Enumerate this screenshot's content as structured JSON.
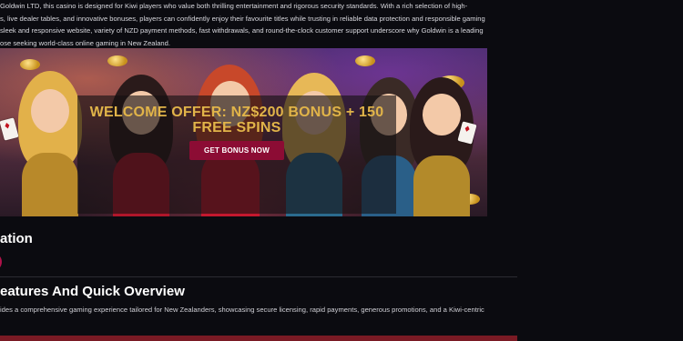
{
  "intro": {
    "lines": [
      "Goldwin LTD, this casino is designed for Kiwi players who value both thrilling entertainment and rigorous security standards. With a rich selection of high-",
      "s, live dealer tables, and innovative bonuses, players can confidently enjoy their favourite titles while trusting in reliable data protection and responsible gaming",
      "sleek and responsive website, variety of NZD payment methods, fast withdrawals, and round-the-clock customer support underscore why Goldwin is a leading",
      "ose seeking world-class online gaming in New Zealand."
    ]
  },
  "banner": {
    "offer_title": "WELCOME OFFER: NZ$200 BONUS + 150 FREE SPINS",
    "button_label": "GET BONUS NOW"
  },
  "sections": {
    "first_title": "ation",
    "second_title": "eatures And Quick Overview",
    "second_text": "ides a comprehensive gaming experience tailored for New Zealanders, showcasing secure licensing, rapid payments, generous promotions, and a Kiwi-centric"
  },
  "colors": {
    "background": "#0b0b10",
    "accent_gold": "#e1b449",
    "button": "#8c0c34",
    "pill": "#b0124a"
  }
}
